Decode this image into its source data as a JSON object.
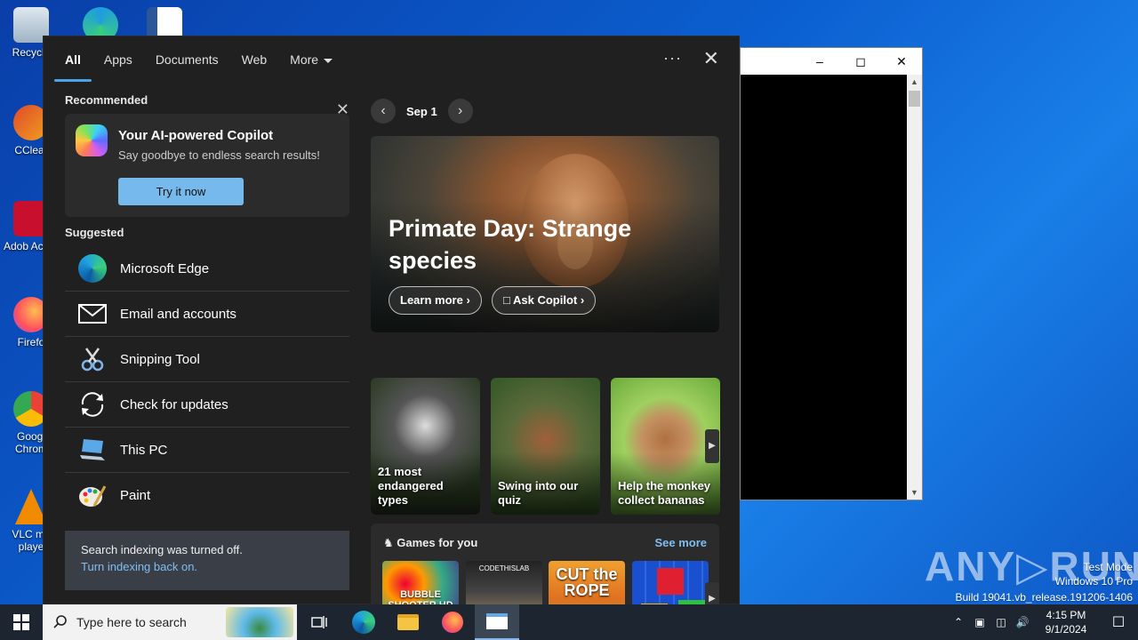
{
  "desktop": {
    "icons": [
      {
        "label": "Recycle"
      },
      {
        "label": "CClear"
      },
      {
        "label": "Adob Acrob"
      },
      {
        "label": "Firefo"
      },
      {
        "label": "Googl Chrom"
      },
      {
        "label": "VLC me playe"
      }
    ]
  },
  "search_panel": {
    "tabs": [
      "All",
      "Apps",
      "Documents",
      "Web",
      "More"
    ],
    "active_tab": "All",
    "recommended_title": "Recommended",
    "copilot": {
      "title": "Your AI-powered Copilot",
      "subtitle": "Say goodbye to endless search results!",
      "button": "Try it now"
    },
    "suggested_title": "Suggested",
    "suggested": [
      {
        "label": "Microsoft Edge",
        "icon": "edge-icon"
      },
      {
        "label": "Email and accounts",
        "icon": "mail-icon"
      },
      {
        "label": "Snipping Tool",
        "icon": "snipping-tool-icon"
      },
      {
        "label": "Check for updates",
        "icon": "refresh-icon"
      },
      {
        "label": "This PC",
        "icon": "computer-icon"
      },
      {
        "label": "Paint",
        "icon": "paint-icon"
      }
    ],
    "indexing": {
      "line1": "Search indexing was turned off.",
      "link": "Turn indexing back on."
    },
    "date": "Sep 1",
    "hero": {
      "title": "Primate Day: Strange species",
      "learn_more": "Learn more",
      "ask_copilot": "Ask Copilot"
    },
    "cards": [
      {
        "caption": "21 most endangered types"
      },
      {
        "caption": "Swing into our quiz"
      },
      {
        "caption": "Help the monkey collect bananas"
      }
    ],
    "games": {
      "title": "Games for you",
      "see_more": "See more",
      "items": [
        "BUBBLE SHOOTER HD",
        "CODETHISLAB",
        "CUT the ROPE",
        ""
      ]
    }
  },
  "taskbar": {
    "search_placeholder": "Type here to search",
    "time": "4:15 PM",
    "date": "9/1/2024"
  },
  "watermark": {
    "line1": "Test Mode",
    "line2": "Windows 10 Pro",
    "line3": "Build 19041.vb_release.191206-1406",
    "brand": "ANY.RUN"
  },
  "colors": {
    "accent": "#76b9ed",
    "link": "#7fbdf2",
    "panel_bg": "#202020"
  }
}
